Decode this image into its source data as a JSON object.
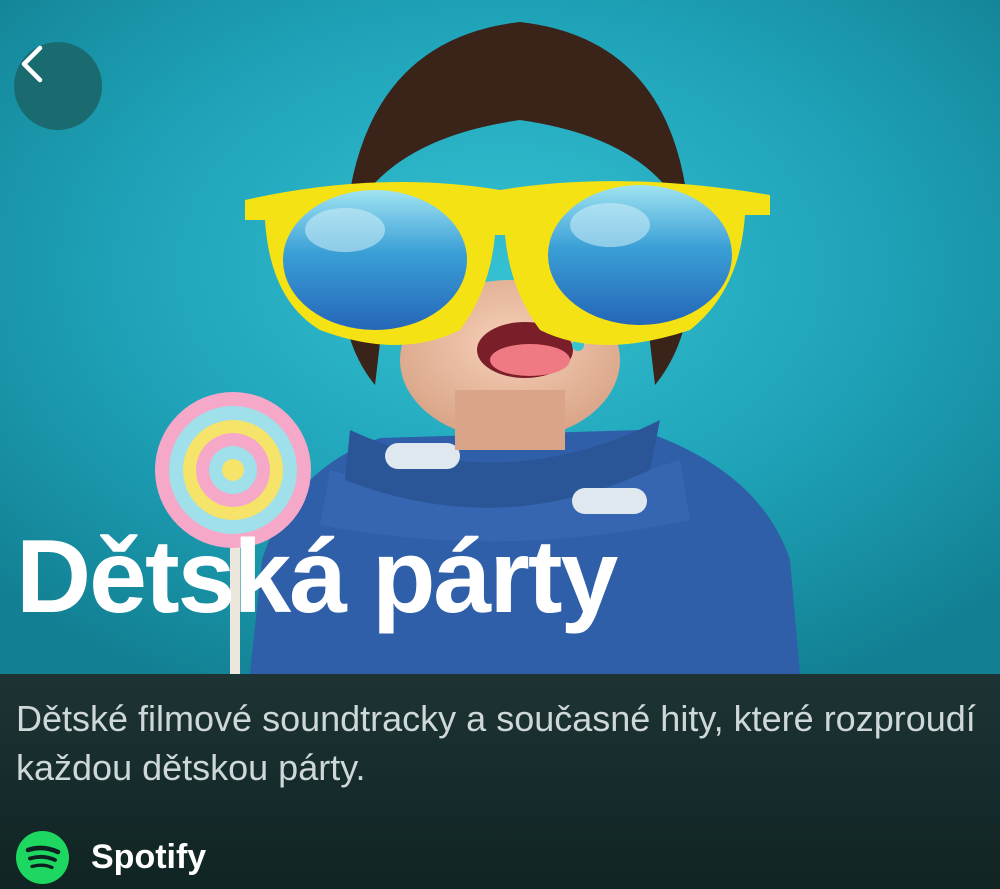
{
  "playlist": {
    "title": "Dětská párty",
    "description": "Dětské filmové soundtracky a současné hity, které rozproudí každou dětskou párty.",
    "owner": "Spotify"
  },
  "colors": {
    "cover_background": "#1fa3b8",
    "info_background": "#1e3434",
    "spotify_green": "#1ed760",
    "sunglasses_yellow": "#f5e214",
    "hoodie_blue": "#2f5fa8"
  },
  "icons": {
    "back": "chevron-left-icon",
    "owner_logo": "spotify-logo-icon"
  }
}
